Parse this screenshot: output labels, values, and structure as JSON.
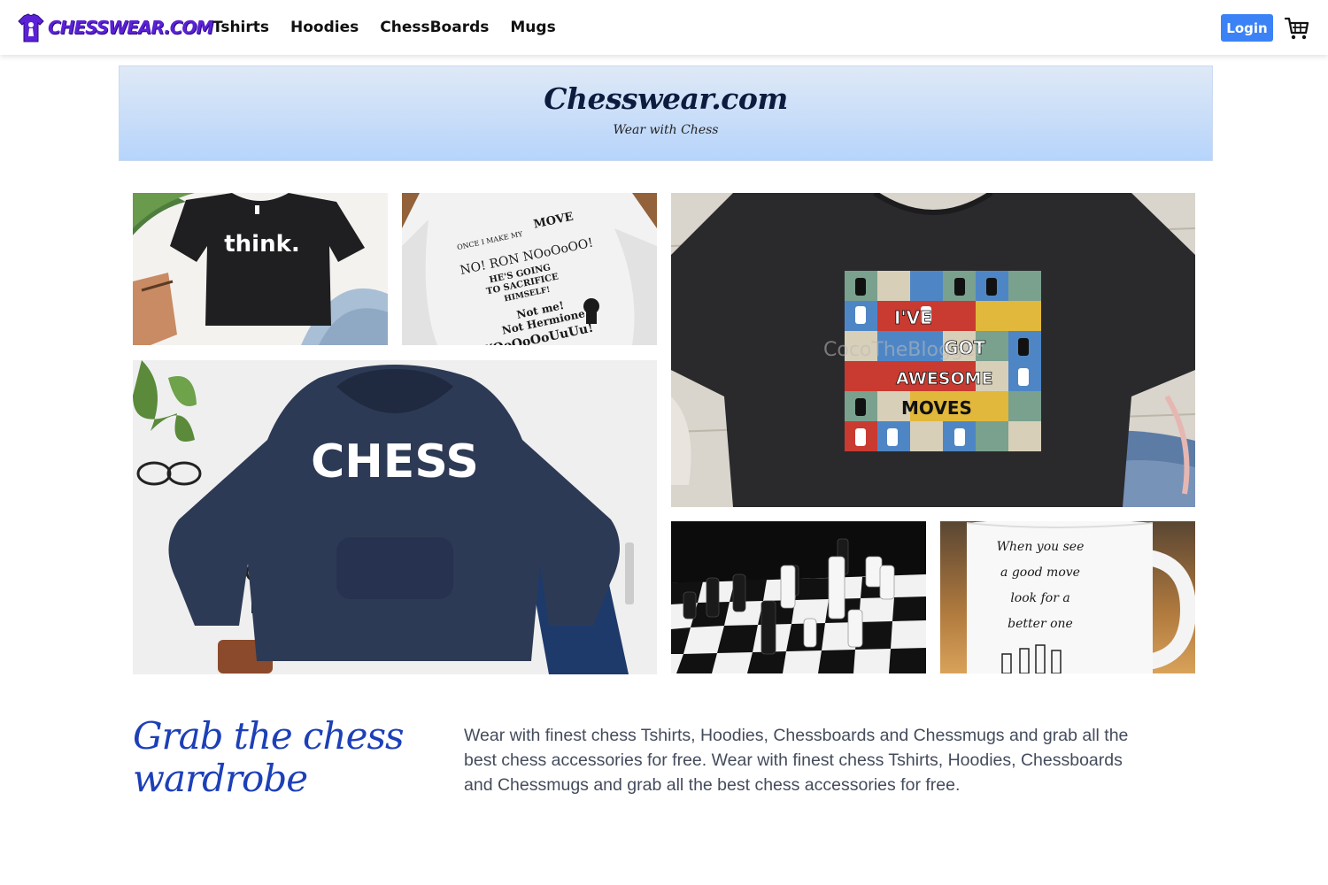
{
  "navbar": {
    "brand": "CHESSWEAR.COM",
    "links": [
      "Tshirts",
      "Hoodies",
      "ChessBoards",
      "Mugs"
    ],
    "login_label": "Login",
    "accent": "#5b21d6",
    "login_color": "#3b82f6"
  },
  "hero": {
    "title": "Chesswear.com",
    "subtitle": "Wear with Chess"
  },
  "gallery": {
    "tshirt_think": "think.",
    "hoodie_move": [
      "ONCE I MAKE MY",
      "MOVE",
      "NO! RON NOoOoOO!",
      "HE'S GOING",
      "TO SACRIFICE",
      "HIMSELF!",
      "Not me!",
      "Not Hermione!",
      "YOoOoOoUuUu!"
    ],
    "tshirt_awesome": [
      "I'VE",
      "GOT",
      "AWESOME",
      "MOVES"
    ],
    "watermark": "CocoTheBlogger",
    "hoodie_chess": "CHESS",
    "mug_quote": [
      "When you see",
      "a good move",
      "look for a",
      "better one"
    ]
  },
  "about": {
    "tagline": "Grab the chess wardrobe",
    "description": "Wear with finest chess Tshirts, Hoodies, Chessboards and Chessmugs and grab all the best chess accessories for free. Wear with finest chess Tshirts, Hoodies, Chessboards and Chessmugs and grab all the best chess accessories for free."
  }
}
